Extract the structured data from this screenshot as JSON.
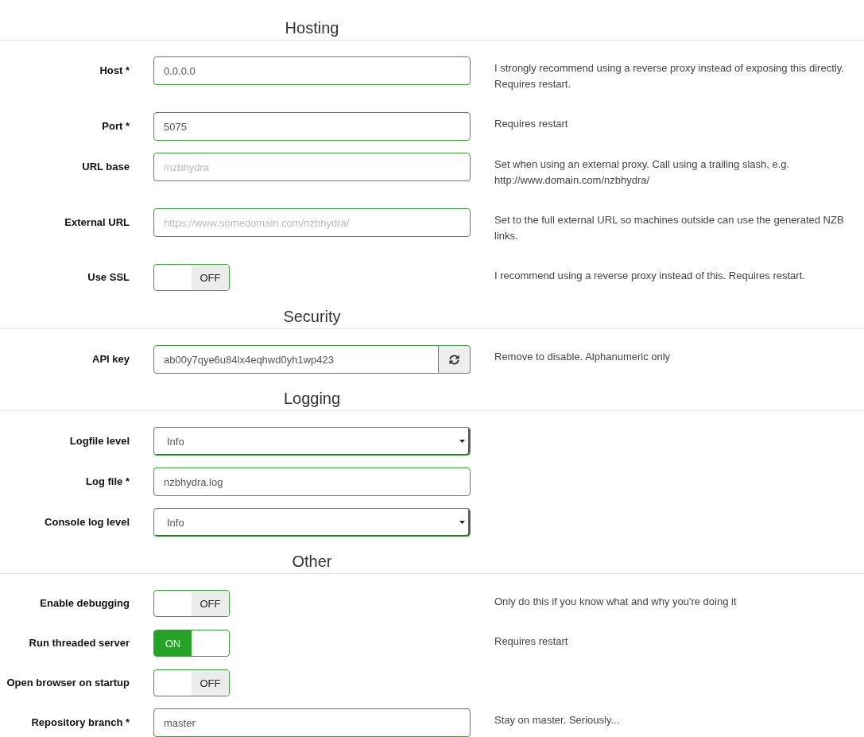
{
  "sections": [
    {
      "title": "Hosting",
      "fields": [
        {
          "kind": "text",
          "label": "Host *",
          "value": "0.0.0.0",
          "help": "I strongly recommend using a reverse proxy instead of exposing this directly. Requires restart."
        },
        {
          "kind": "text",
          "label": "Port *",
          "value": "5075",
          "help": "Requires restart"
        },
        {
          "kind": "text",
          "label": "URL base",
          "placeholder": "/nzbhydra",
          "help": "Set when using an external proxy. Call using a trailing slash, e.g. http://www.domain.com/nzbhydra/"
        },
        {
          "kind": "text",
          "label": "External URL",
          "placeholder": "https://www.somedomain.com/nzbhydra/",
          "help": "Set to the full external URL so machines outside can use the generated NZB links."
        },
        {
          "kind": "toggle",
          "label": "Use SSL",
          "on": false,
          "switch_text": "OFF",
          "help": "I recommend using a reverse proxy instead of this. Requires restart."
        }
      ]
    },
    {
      "title": "Security",
      "fields": [
        {
          "kind": "key",
          "label": "API key",
          "value": "ab00y7qye6u84lx4eqhwd0yh1wp423",
          "help": "Remove to disable. Alphanumeric only"
        }
      ]
    },
    {
      "title": "Logging",
      "fields": [
        {
          "kind": "select",
          "label": "Logfile level",
          "value": "Info"
        },
        {
          "kind": "text",
          "label": "Log file *",
          "value": "nzbhydra.log"
        },
        {
          "kind": "select",
          "label": "Console log level",
          "value": "Info"
        }
      ]
    },
    {
      "title": "Other",
      "fields": [
        {
          "kind": "toggle",
          "label": "Enable debugging",
          "on": false,
          "switch_text": "OFF",
          "help": "Only do this if you know what and why you're doing it"
        },
        {
          "kind": "toggle",
          "label": "Run threaded server",
          "on": true,
          "switch_text": "ON",
          "help": "Requires restart"
        },
        {
          "kind": "toggle",
          "label": "Open browser on startup",
          "on": false,
          "switch_text": "OFF"
        },
        {
          "kind": "text",
          "label": "Repository branch *",
          "value": "master",
          "help": "Stay on master. Seriously..."
        }
      ]
    }
  ]
}
